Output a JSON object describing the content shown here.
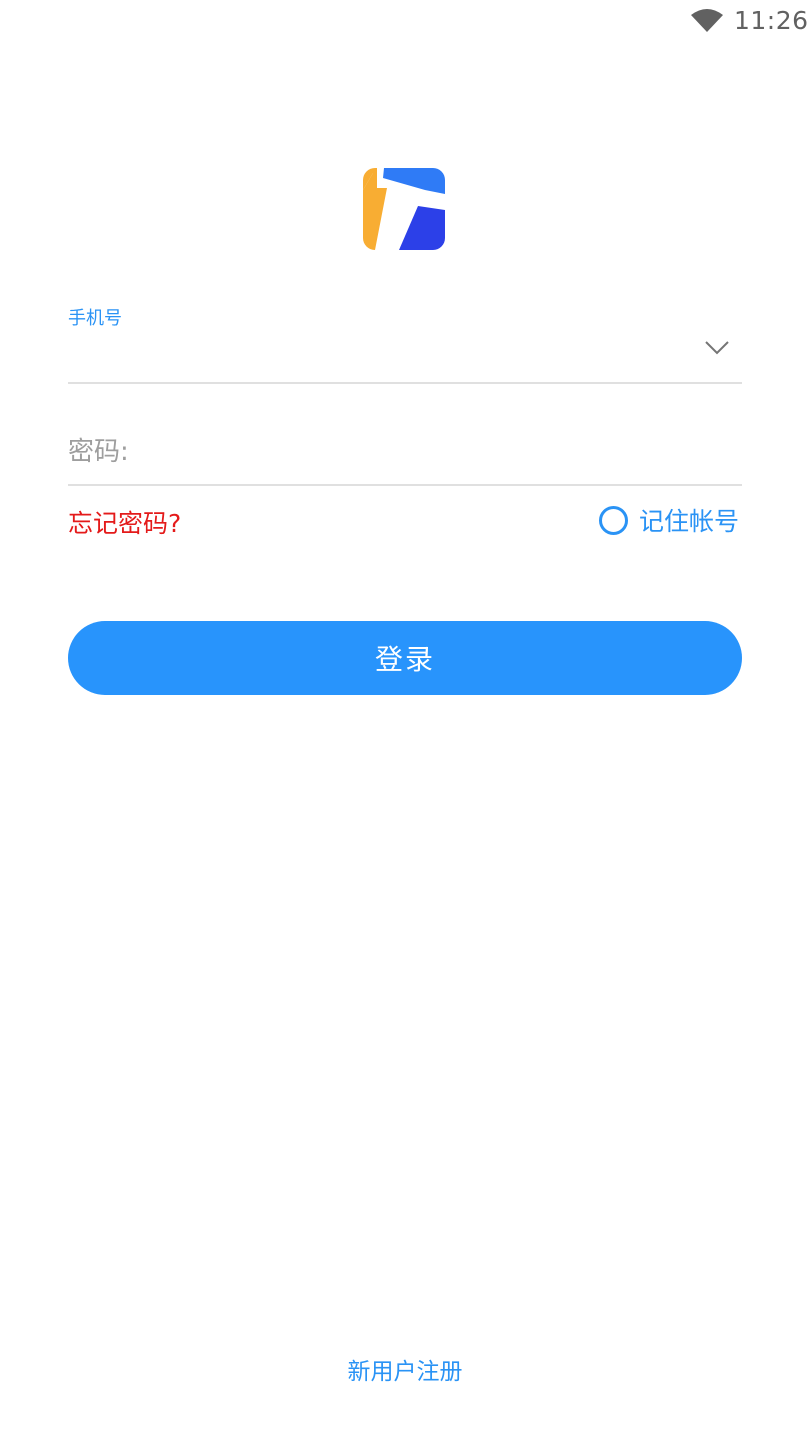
{
  "status_bar": {
    "time": "11:26",
    "wifi_icon": "wifi-icon"
  },
  "logo": {
    "icon": "app-logo",
    "colors": {
      "orange": "#f8ad33",
      "blue_light": "#2f7bf6",
      "blue_dark": "#2c40e8"
    }
  },
  "form": {
    "phone_label": "手机号",
    "phone_value": "",
    "phone_dropdown_icon": "chevron-down-icon",
    "password_placeholder": "密码:",
    "password_value": "",
    "forgot_password": "忘记密码?",
    "remember_account": "记住帐号",
    "remember_checked": false
  },
  "login_button": "登录",
  "register_link": "新用户注册",
  "colors": {
    "accent": "#2894fc",
    "link_blue": "#2a93f5",
    "error_red": "#e41a1a",
    "divider": "#e0e0e0"
  }
}
